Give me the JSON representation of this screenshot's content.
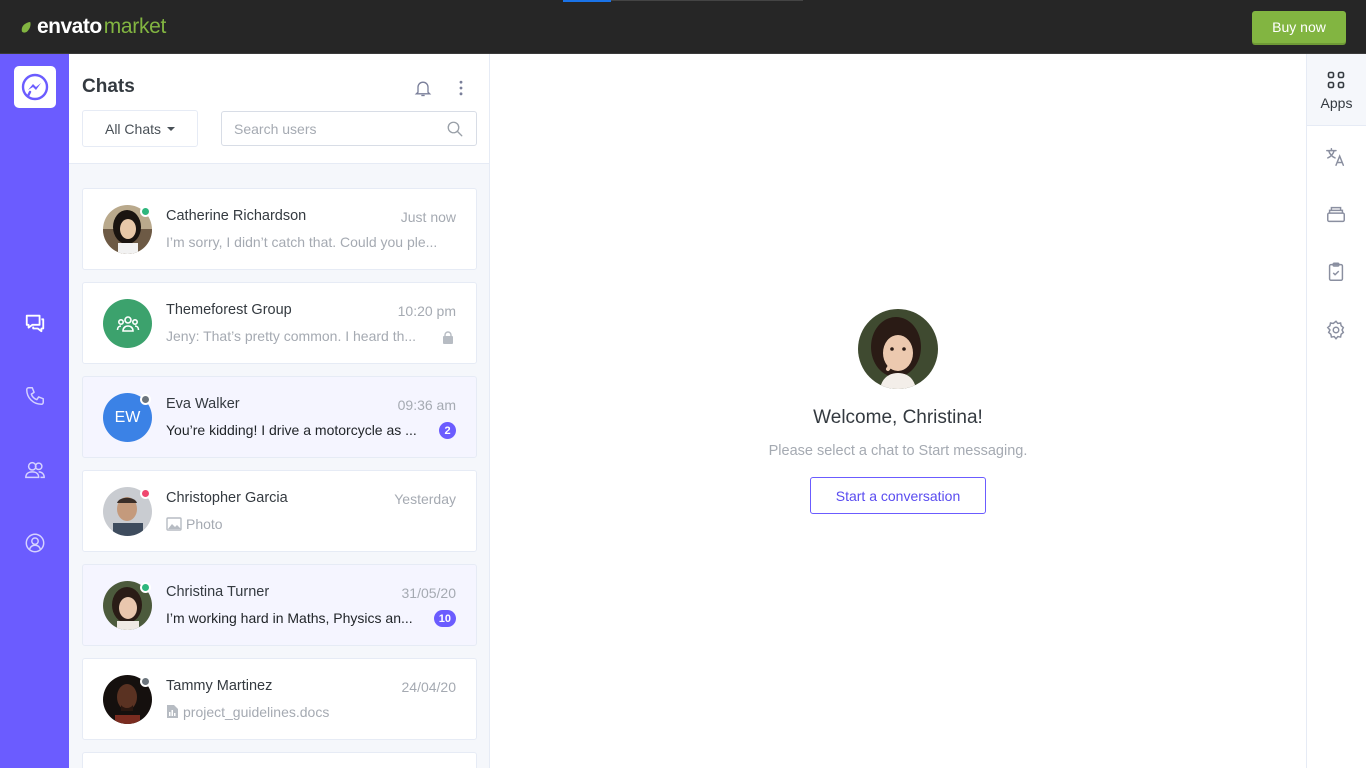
{
  "topbar": {
    "logo_part1": "envato",
    "logo_part2": "market",
    "buy_label": "Buy now"
  },
  "rail": {
    "items": [
      "chats-icon",
      "phone-icon",
      "contacts-icon",
      "profile-icon"
    ],
    "active": "chats-icon"
  },
  "chats": {
    "title": "Chats",
    "filter_label": "All Chats",
    "search_placeholder": "Search users",
    "items": [
      {
        "name": "Catherine Richardson",
        "time": "Just now",
        "message": "I’m sorry, I didn’t catch that. Could you ple...",
        "status": "online",
        "unread": false
      },
      {
        "name": "Themeforest Group",
        "time": "10:20 pm",
        "message": "Jeny: That’s pretty common. I heard th...",
        "status": "group",
        "unread": false
      },
      {
        "name": "Eva Walker",
        "time": "09:36 am",
        "message": "You’re kidding! I drive a motorcycle as ...",
        "status": "away",
        "unread": true,
        "initials": "EW",
        "badge": "2"
      },
      {
        "name": "Christopher Garcia",
        "time": "Yesterday",
        "message": "Photo",
        "status": "busy",
        "unread": false
      },
      {
        "name": "Christina Turner",
        "time": "31/05/20",
        "message": "I’m working hard in Maths, Physics an...",
        "status": "online",
        "unread": true,
        "badge": "10"
      },
      {
        "name": "Tammy Martinez",
        "time": "24/04/20",
        "message": "project_guidelines.docs",
        "status": "away",
        "unread": false
      }
    ]
  },
  "main": {
    "welcome_title": "Welcome, Christina!",
    "welcome_sub": "Please select a chat to Start messaging.",
    "start_label": "Start a conversation"
  },
  "right_rail": {
    "apps_label": "Apps",
    "icons": [
      "translate-icon",
      "archive-icon",
      "tasks-icon",
      "settings-icon"
    ]
  },
  "colors": {
    "primary": "#6b5cff",
    "envato_green": "#82b541",
    "online": "#2eb67d",
    "busy": "#ef476f",
    "away": "#6c757d"
  }
}
